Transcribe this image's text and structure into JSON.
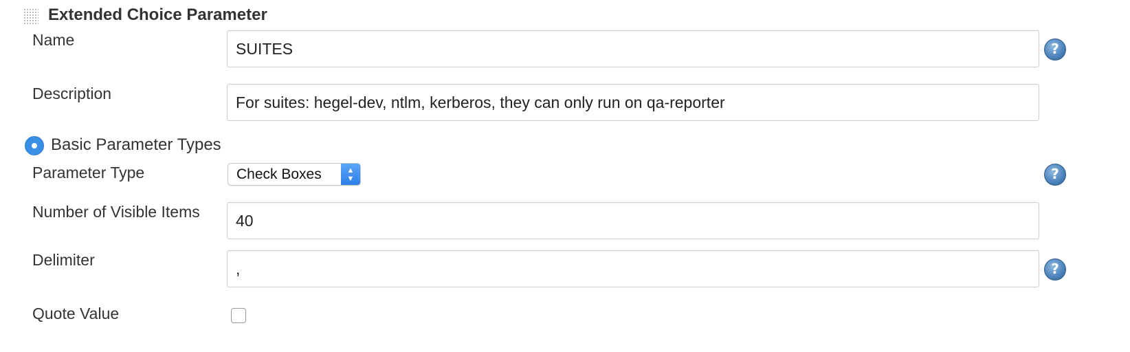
{
  "section": {
    "title": "Extended Choice Parameter",
    "grip_icon": "drag-handle-icon"
  },
  "fields": {
    "name": {
      "label": "Name",
      "value": "SUITES"
    },
    "description": {
      "label": "Description",
      "value": "For suites: hegel-dev, ntlm, kerberos, they can only run on qa-reporter"
    },
    "parameter_type": {
      "label": "Parameter Type",
      "value": "Check Boxes"
    },
    "visible_items": {
      "label": "Number of Visible Items",
      "value": "40"
    },
    "delimiter": {
      "label": "Delimiter",
      "value": ","
    },
    "quote_value": {
      "label": "Quote Value",
      "checked": false
    }
  },
  "radio": {
    "label": "Basic Parameter Types",
    "selected": true
  },
  "help": {
    "glyph": "?",
    "icon": "help-icon"
  },
  "colors": {
    "accent": "#3a8ee6",
    "help_blue": "#4f86bf",
    "text": "#333333"
  }
}
